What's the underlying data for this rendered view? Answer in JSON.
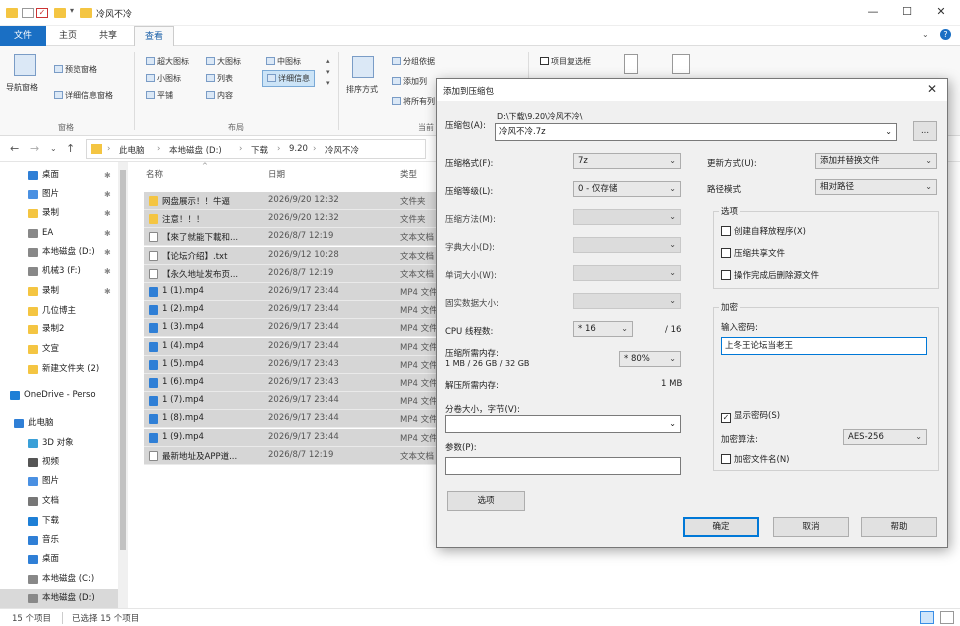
{
  "window": {
    "title": "冷风不冷",
    "minimize": "—",
    "maximize": "☐",
    "close": "✕"
  },
  "ribbon_tabs": [
    "文件",
    "主页",
    "共享",
    "查看"
  ],
  "ribbon": {
    "nav_pane": "导航窗格",
    "preview_pane": "预览窗格",
    "details_pane": "详细信息窗格",
    "group_panes": "窗格",
    "layout_items": [
      "超大图标",
      "大图标",
      "中图标",
      "小图标",
      "列表",
      "详细信息",
      "平铺",
      "内容"
    ],
    "group_layout": "布局",
    "sort_by": "排序方式",
    "group_by": "分组依据",
    "add_columns": "添加列",
    "size_all_columns": "将所有列",
    "group_current": "当前",
    "item_checkbox": "项目复选框"
  },
  "address": {
    "crumbs": [
      "此电脑",
      "本地磁盘 (D:)",
      "下载",
      "9.20",
      "冷风不冷"
    ]
  },
  "nav_items": [
    {
      "label": "桌面",
      "pinned": true,
      "color": "#2f7fd6"
    },
    {
      "label": "图片",
      "pinned": true,
      "color": "#4a90e2"
    },
    {
      "label": "录制",
      "pinned": true,
      "color": "#f4c542"
    },
    {
      "label": "EA",
      "pinned": true,
      "color": "#888888"
    },
    {
      "label": "本地磁盘 (D:)",
      "pinned": true,
      "color": "#888888"
    },
    {
      "label": "机械3 (F:)",
      "pinned": true,
      "color": "#888888"
    },
    {
      "label": "录制",
      "pinned": true,
      "color": "#f4c542"
    },
    {
      "label": "几位博主",
      "pinned": false,
      "color": "#f4c542"
    },
    {
      "label": "录制2",
      "pinned": false,
      "color": "#f4c542"
    },
    {
      "label": "文宣",
      "pinned": false,
      "color": "#f4c542"
    },
    {
      "label": "新建文件夹 (2)",
      "pinned": false,
      "color": "#f4c542"
    },
    {
      "label": "OneDrive - Perso",
      "pinned": false,
      "color": "#1e7fd6"
    },
    {
      "label": "此电脑",
      "pinned": false,
      "color": "#2f7fd6"
    },
    {
      "label": "3D 对象",
      "pinned": false,
      "color": "#3aa0d8"
    },
    {
      "label": "视频",
      "pinned": false,
      "color": "#555555"
    },
    {
      "label": "图片",
      "pinned": false,
      "color": "#4a90e2"
    },
    {
      "label": "文档",
      "pinned": false,
      "color": "#777777"
    },
    {
      "label": "下载",
      "pinned": false,
      "color": "#1e7fd6"
    },
    {
      "label": "音乐",
      "pinned": false,
      "color": "#2f7fd6"
    },
    {
      "label": "桌面",
      "pinned": false,
      "color": "#2f7fd6"
    },
    {
      "label": "本地磁盘 (C:)",
      "pinned": false,
      "color": "#888888"
    },
    {
      "label": "本地磁盘 (D:)",
      "pinned": false,
      "color": "#888888"
    }
  ],
  "file_headers": {
    "name": "名称",
    "date": "日期",
    "type": "类型"
  },
  "files": [
    {
      "name": "网盘展示！！牛逼",
      "date": "2026/9/20 12:32",
      "type": "文件夹",
      "kind": "folder"
    },
    {
      "name": "注意！！！",
      "date": "2026/9/20 12:32",
      "type": "文件夹",
      "kind": "folder"
    },
    {
      "name": "【來了就能下載和...",
      "date": "2026/8/7 12:19",
      "type": "文本文档",
      "kind": "doc"
    },
    {
      "name": "【论坛介绍】.txt",
      "date": "2026/9/12 10:28",
      "type": "文本文档",
      "kind": "doc"
    },
    {
      "name": "【永久地址发布页...",
      "date": "2026/8/7 12:19",
      "type": "文本文档",
      "kind": "doc"
    },
    {
      "name": "1 (1).mp4",
      "date": "2026/9/17 23:44",
      "type": "MP4 文件",
      "kind": "video"
    },
    {
      "name": "1 (2).mp4",
      "date": "2026/9/17 23:44",
      "type": "MP4 文件",
      "kind": "video"
    },
    {
      "name": "1 (3).mp4",
      "date": "2026/9/17 23:44",
      "type": "MP4 文件",
      "kind": "video"
    },
    {
      "name": "1 (4).mp4",
      "date": "2026/9/17 23:44",
      "type": "MP4 文件",
      "kind": "video"
    },
    {
      "name": "1 (5).mp4",
      "date": "2026/9/17 23:43",
      "type": "MP4 文件",
      "kind": "video"
    },
    {
      "name": "1 (6).mp4",
      "date": "2026/9/17 23:43",
      "type": "MP4 文件",
      "kind": "video"
    },
    {
      "name": "1 (7).mp4",
      "date": "2026/9/17 23:44",
      "type": "MP4 文件",
      "kind": "video"
    },
    {
      "name": "1 (8).mp4",
      "date": "2026/9/17 23:44",
      "type": "MP4 文件",
      "kind": "video"
    },
    {
      "name": "1 (9).mp4",
      "date": "2026/9/17 23:44",
      "type": "MP4 文件",
      "kind": "video"
    },
    {
      "name": "最新地址及APP道...",
      "date": "2026/8/7 12:19",
      "type": "文本文档",
      "kind": "doc"
    }
  ],
  "status": {
    "count": "15 个项目",
    "selected": "已选择 15 个项目"
  },
  "dialog": {
    "title": "添加到压缩包",
    "archive_label": "压缩包(A):",
    "archive_dir": "D:\\下载\\9.20\\冷风不冷\\",
    "archive_name": "冷风不冷.7z",
    "browse": "...",
    "format_label": "压缩格式(F):",
    "format_value": "7z",
    "level_label": "压缩等级(L):",
    "level_value": "0 - 仅存储",
    "method_label": "压缩方法(M):",
    "dict_label": "字典大小(D):",
    "word_label": "单词大小(W):",
    "solid_label": "固实数据大小:",
    "cpu_label": "CPU 线程数:",
    "cpu_value": "* 16",
    "cpu_total": "/ 16",
    "mem_comp_label": "压缩所需内存:",
    "mem_comp_detail": "1 MB / 26 GB / 32 GB",
    "mem_percent": "* 80%",
    "mem_decomp_label": "解压所需内存:",
    "mem_decomp_value": "1 MB",
    "split_label": "分卷大小，字节(V):",
    "params_label": "参数(P):",
    "options_btn": "选项",
    "update_label": "更新方式(U):",
    "update_value": "添加并替换文件",
    "path_label": "路径模式",
    "path_value": "相对路径",
    "options_group": "选项",
    "opt_sfx": "创建自释放程序(X)",
    "opt_shared": "压缩共享文件",
    "opt_delete": "操作完成后删除源文件",
    "enc_group": "加密",
    "pwd_label": "输入密码:",
    "pwd_value": "上冬王论坛当老王",
    "show_pwd": "显示密码(S)",
    "enc_method_label": "加密算法:",
    "enc_method_value": "AES-256",
    "enc_names": "加密文件名(N)",
    "ok": "确定",
    "cancel": "取消",
    "help": "帮助"
  }
}
